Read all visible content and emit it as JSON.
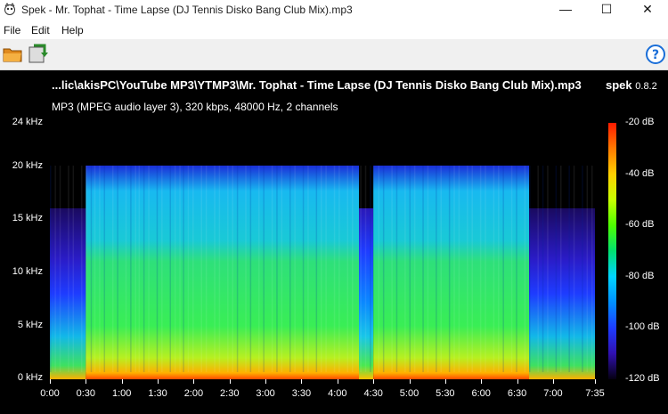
{
  "window": {
    "title": "Spek - Mr. Tophat - Time Lapse (DJ Tennis Disko Bang Club Mix).mp3",
    "minimize_glyph": "—",
    "maximize_glyph": "☐",
    "close_glyph": "✕"
  },
  "menu": {
    "items": [
      "File",
      "Edit",
      "Help"
    ]
  },
  "toolbar": {
    "open_icon": "folder-icon",
    "save_icon": "save-icon",
    "help_icon": "help-icon",
    "help_glyph": "?"
  },
  "header": {
    "file_path": "...lic\\akisPC\\YouTube MP3\\YTMP3\\Mr. Tophat - Time Lapse (DJ Tennis Disko Bang Club Mix).mp3",
    "app_name": "spek",
    "app_version": "0.8.2",
    "stream_info": "MP3 (MPEG audio layer 3), 320 kbps, 48000 Hz, 2 channels"
  },
  "chart_data": {
    "type": "heatmap",
    "title": "",
    "y_axis": {
      "label": "",
      "unit": "kHz",
      "range": [
        0,
        24
      ],
      "ticks": [
        "24 kHz",
        "20 kHz",
        "15 kHz",
        "10 kHz",
        "5 kHz",
        "0 kHz"
      ],
      "tick_values": [
        24,
        20,
        15,
        10,
        5,
        0
      ]
    },
    "x_axis": {
      "label": "",
      "range_seconds": [
        0,
        455
      ],
      "ticks": [
        "0:00",
        "0:30",
        "1:00",
        "1:30",
        "2:00",
        "2:30",
        "3:00",
        "3:30",
        "4:00",
        "4:30",
        "5:00",
        "5:30",
        "6:00",
        "6:30",
        "7:00",
        "7:35"
      ],
      "tick_seconds": [
        0,
        30,
        60,
        90,
        120,
        150,
        180,
        210,
        240,
        270,
        300,
        330,
        360,
        390,
        420,
        455
      ]
    },
    "color_scale": {
      "unit": "dB",
      "range": [
        -120,
        -20
      ],
      "ticks": [
        "-20 dB",
        "-40 dB",
        "-60 dB",
        "-80 dB",
        "-100 dB",
        "-120 dB"
      ],
      "tick_values": [
        -20,
        -40,
        -60,
        -80,
        -100,
        -120
      ]
    },
    "cutoff_khz": 20,
    "sections": [
      {
        "start": 0,
        "end": 30,
        "top_khz": 16
      },
      {
        "start": 30,
        "end": 258,
        "top_khz": 20
      },
      {
        "start": 258,
        "end": 270,
        "top_khz": 16
      },
      {
        "start": 270,
        "end": 400,
        "top_khz": 20
      },
      {
        "start": 400,
        "end": 455,
        "top_khz": 16
      }
    ]
  }
}
